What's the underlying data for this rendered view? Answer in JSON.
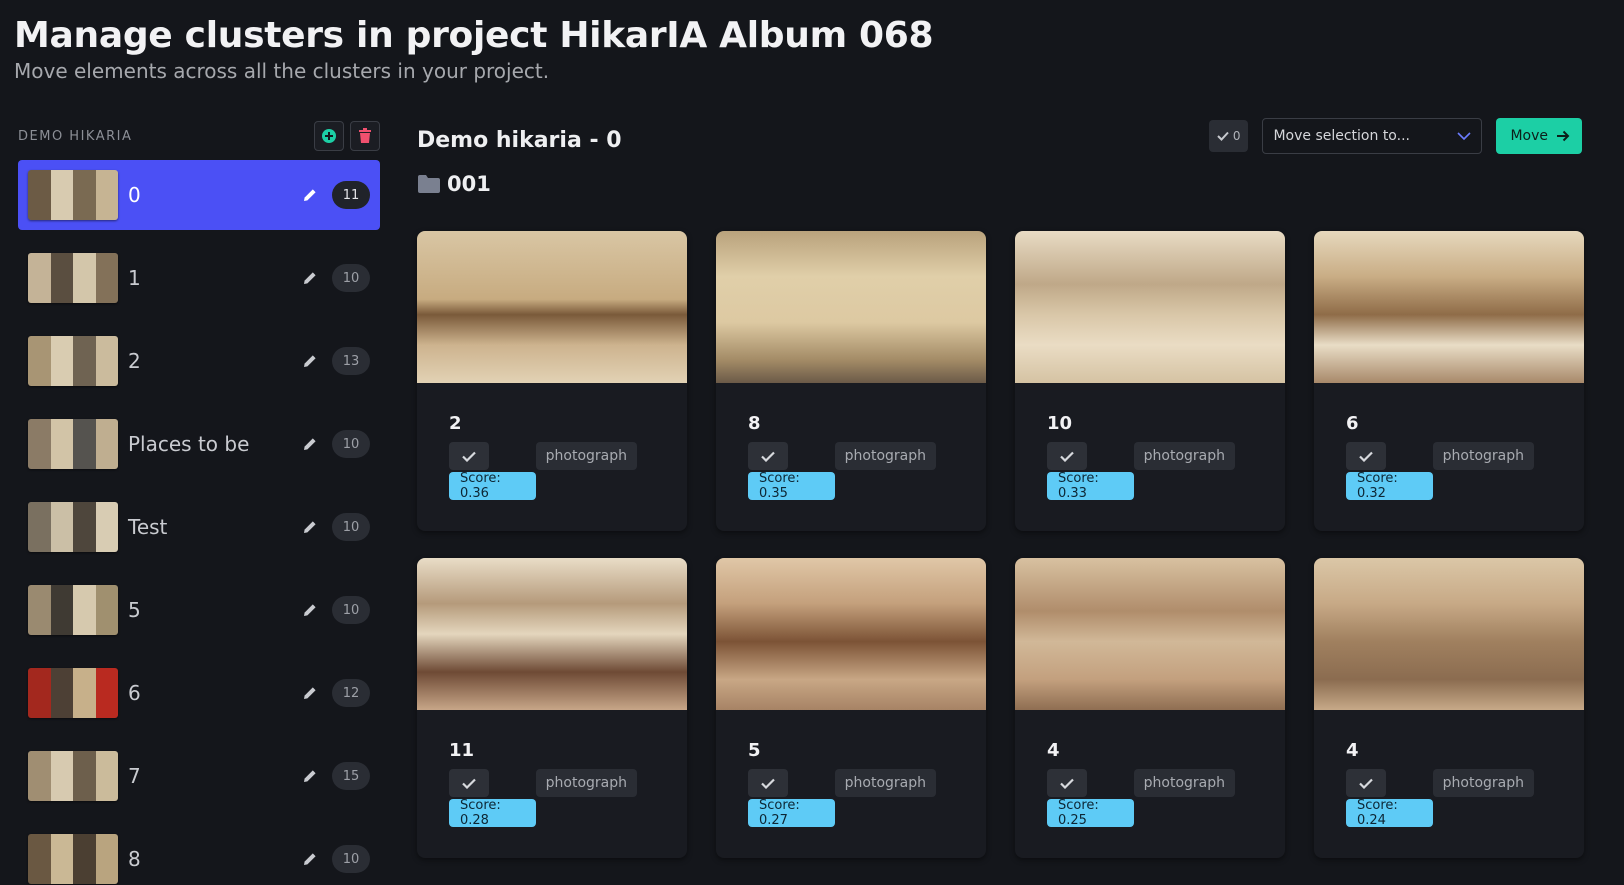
{
  "header": {
    "title": "Manage clusters in project HikarIA Album 068",
    "subtitle": "Move elements across all the clusters in your project."
  },
  "sidebar": {
    "project_name": "DEMO HIKARIA",
    "add_icon": "plus-circle-icon",
    "delete_icon": "trash-icon",
    "clusters": [
      {
        "label": "0",
        "count": "11",
        "active": true
      },
      {
        "label": "1",
        "count": "10"
      },
      {
        "label": "2",
        "count": "13"
      },
      {
        "label": "Places to be",
        "count": "10"
      },
      {
        "label": "Test",
        "count": "10"
      },
      {
        "label": "5",
        "count": "10"
      },
      {
        "label": "6",
        "count": "12"
      },
      {
        "label": "7",
        "count": "15"
      },
      {
        "label": "8",
        "count": "10"
      }
    ]
  },
  "main": {
    "title": "Demo hikaria - 0",
    "folder": "001",
    "selection_count": "0",
    "move_select_placeholder": "Move selection to...",
    "move_button_label": "Move",
    "cards": [
      {
        "title": "2",
        "type": "photograph",
        "score": "Score: 0.36"
      },
      {
        "title": "8",
        "type": "photograph",
        "score": "Score: 0.35"
      },
      {
        "title": "10",
        "type": "photograph",
        "score": "Score: 0.33"
      },
      {
        "title": "6",
        "type": "photograph",
        "score": "Score: 0.32"
      },
      {
        "title": "11",
        "type": "photograph",
        "score": "Score: 0.28"
      },
      {
        "title": "5",
        "type": "photograph",
        "score": "Score: 0.27"
      },
      {
        "title": "4",
        "type": "photograph",
        "score": "Score: 0.25"
      },
      {
        "title": "4",
        "type": "photograph",
        "score": "Score: 0.24"
      }
    ]
  },
  "colors": {
    "background": "#14161b",
    "active_cluster": "#4b50f5",
    "move_button": "#1ccfa5",
    "score_tag": "#5ecbf6",
    "add_icon": "#1ccfa5",
    "delete_icon": "#f0506e"
  }
}
